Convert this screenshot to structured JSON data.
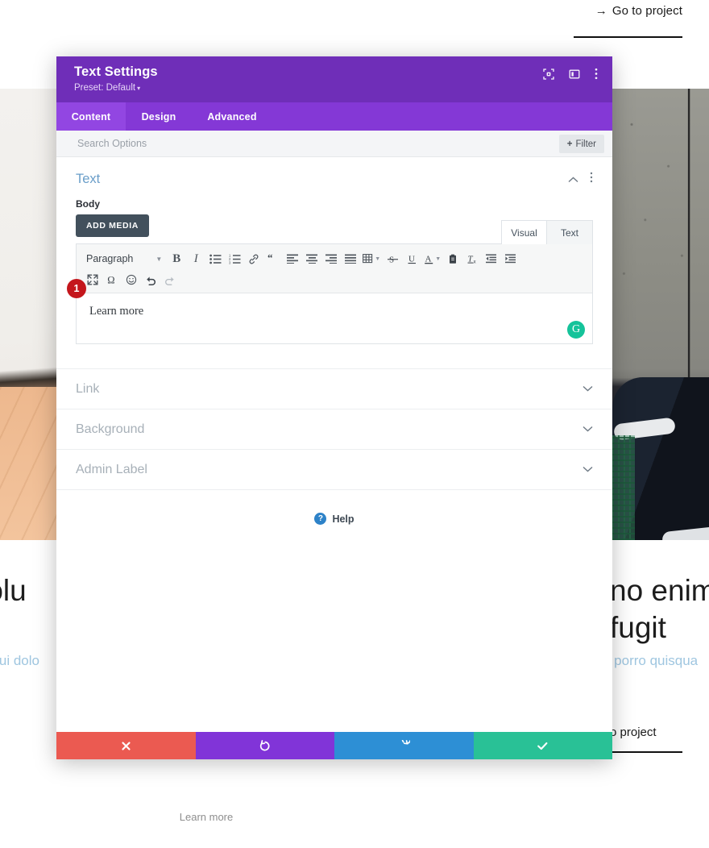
{
  "background_page": {
    "top_link": {
      "arrow": "→",
      "label": "Go to project"
    },
    "left_column": {
      "heading": "n volu",
      "subtext": ", qui dolo"
    },
    "right_column": {
      "heading_line1": "no enim ip",
      "heading_line2": "fugit",
      "subtext": "e porro quisqua",
      "link": "o project"
    },
    "bottom_learn_more": "Learn more"
  },
  "modal": {
    "title": "Text Settings",
    "preset": "Preset: Default",
    "preset_caret": "▾",
    "header_icons": [
      {
        "name": "focus-icon",
        "glyph": "⊙"
      },
      {
        "name": "layout-panel-icon",
        "glyph": "▥"
      },
      {
        "name": "kebab-menu-icon",
        "glyph": "⋮"
      }
    ],
    "tabs": [
      {
        "label": "Content",
        "active": true
      },
      {
        "label": "Design",
        "active": false
      },
      {
        "label": "Advanced",
        "active": false
      }
    ],
    "search": {
      "value": "",
      "placeholder": "Search Options"
    },
    "filter_button": {
      "plus": "+",
      "label": "Filter"
    },
    "section": {
      "title": "Text",
      "collapse_icon": "⌃",
      "kebab_icon": "⋮"
    },
    "body_field": {
      "label": "Body",
      "add_media_label": "ADD MEDIA",
      "editor_tabs": [
        {
          "label": "Visual",
          "active": true
        },
        {
          "label": "Text",
          "active": false
        }
      ],
      "format_select": "Paragraph",
      "toolbar_row1": [
        {
          "name": "bold-icon",
          "glyph": "B"
        },
        {
          "name": "italic-icon",
          "glyph": "I"
        },
        {
          "name": "bullet-list-icon",
          "glyph": "☰"
        },
        {
          "name": "numbered-list-icon",
          "glyph": "≡"
        },
        {
          "name": "link-icon",
          "glyph": "🔗"
        },
        {
          "name": "blockquote-icon",
          "glyph": "❝"
        },
        {
          "name": "align-left-icon",
          "glyph": "≡"
        },
        {
          "name": "align-center-icon",
          "glyph": "≡"
        },
        {
          "name": "align-right-icon",
          "glyph": "≡"
        },
        {
          "name": "justify-icon",
          "glyph": "≡"
        },
        {
          "name": "table-icon",
          "glyph": "▦"
        },
        {
          "name": "strikethrough-icon",
          "glyph": "S"
        },
        {
          "name": "underline-icon",
          "glyph": "U"
        },
        {
          "name": "text-color-icon",
          "glyph": "A"
        },
        {
          "name": "paste-as-text-icon",
          "glyph": "📋"
        },
        {
          "name": "clear-formatting-icon",
          "glyph": "T"
        },
        {
          "name": "outdent-icon",
          "glyph": "⇤"
        },
        {
          "name": "indent-icon",
          "glyph": "⇥"
        }
      ],
      "toolbar_row2": [
        {
          "name": "fullscreen-icon",
          "glyph": "⤢"
        },
        {
          "name": "special-character-icon",
          "glyph": "Ω"
        },
        {
          "name": "emoji-icon",
          "glyph": "☺"
        },
        {
          "name": "undo-icon",
          "glyph": "↩"
        },
        {
          "name": "redo-icon",
          "glyph": "↪"
        }
      ],
      "content_text": "Learn more",
      "grammarly_glyph": "G",
      "step_badge": "1"
    },
    "accordions": [
      {
        "label": "Link",
        "chevron": "⌄"
      },
      {
        "label": "Background",
        "chevron": "⌄"
      },
      {
        "label": "Admin Label",
        "chevron": "⌄"
      }
    ],
    "help": {
      "icon": "?",
      "label": "Help"
    },
    "footer_buttons": [
      {
        "name": "cancel-button",
        "glyph": "✖",
        "color": "#eb5a51"
      },
      {
        "name": "undo-button",
        "glyph": "↺",
        "color": "#8134d8"
      },
      {
        "name": "redo-button",
        "glyph": "↻",
        "color": "#2d8fd5"
      },
      {
        "name": "save-button",
        "glyph": "✔",
        "color": "#29c196"
      }
    ]
  },
  "colors": {
    "header_purple": "#6f2eb8",
    "tabbar_purple": "#8438d6",
    "active_tab_purple": "#9246e2",
    "section_title_blue": "#6a9ec9",
    "badge_red": "#c4161c",
    "grammarly_green": "#15c39a"
  }
}
